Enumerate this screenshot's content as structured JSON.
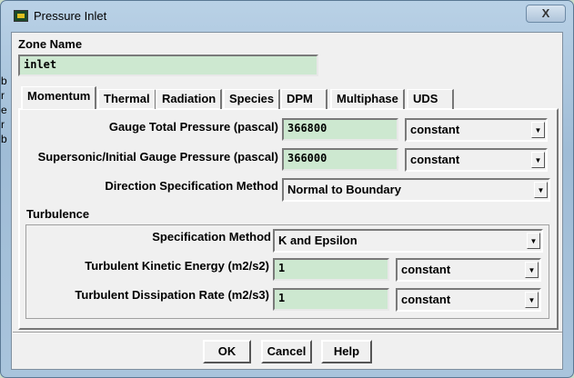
{
  "window": {
    "title": "Pressure Inlet",
    "close_label": "X"
  },
  "background_fragments": [
    "b",
    "r",
    "e",
    "r",
    "b"
  ],
  "zone": {
    "label": "Zone Name",
    "value": "inlet"
  },
  "tabs": [
    "Momentum",
    "Thermal",
    "Radiation",
    "Species",
    "DPM",
    "Multiphase",
    "UDS"
  ],
  "active_tab": "Momentum",
  "momentum": {
    "gauge_total": {
      "label": "Gauge Total Pressure (pascal)",
      "value": "366800",
      "method": "constant"
    },
    "supersonic": {
      "label": "Supersonic/Initial Gauge Pressure (pascal)",
      "value": "366000",
      "method": "constant"
    },
    "direction": {
      "label": "Direction Specification Method",
      "value": "Normal to Boundary"
    }
  },
  "turbulence": {
    "label": "Turbulence",
    "spec": {
      "label": "Specification Method",
      "value": "K and Epsilon"
    },
    "tke": {
      "label": "Turbulent Kinetic Energy (m2/s2)",
      "value": "1",
      "method": "constant"
    },
    "tdr": {
      "label": "Turbulent Dissipation Rate (m2/s3)",
      "value": "1",
      "method": "constant"
    }
  },
  "buttons": {
    "ok": "OK",
    "cancel": "Cancel",
    "help": "Help"
  }
}
